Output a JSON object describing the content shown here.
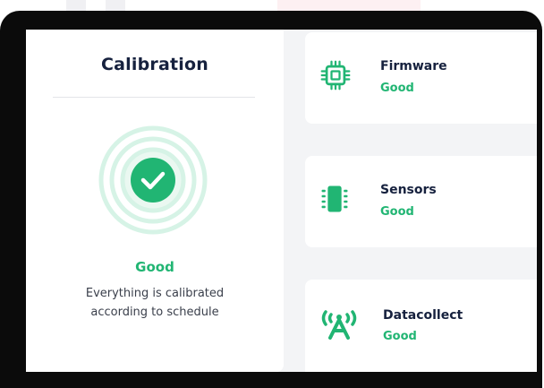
{
  "calibration": {
    "title": "Calibration",
    "status": "Good",
    "description_line1": "Everything is calibrated",
    "description_line2": "according to schedule",
    "icon": "check-circle-icon"
  },
  "components": [
    {
      "label": "Firmware",
      "status": "Good",
      "icon": "chip-icon"
    },
    {
      "label": "Sensors",
      "status": "Good",
      "icon": "sensor-icon"
    },
    {
      "label": "Datacollect",
      "status": "Good",
      "icon": "antenna-icon"
    }
  ],
  "colors": {
    "good": "#21b573",
    "title": "#16213e",
    "ring": "#d6f3e6",
    "frame": "#0b0b0b",
    "screen_bg": "#f3f4f6"
  }
}
